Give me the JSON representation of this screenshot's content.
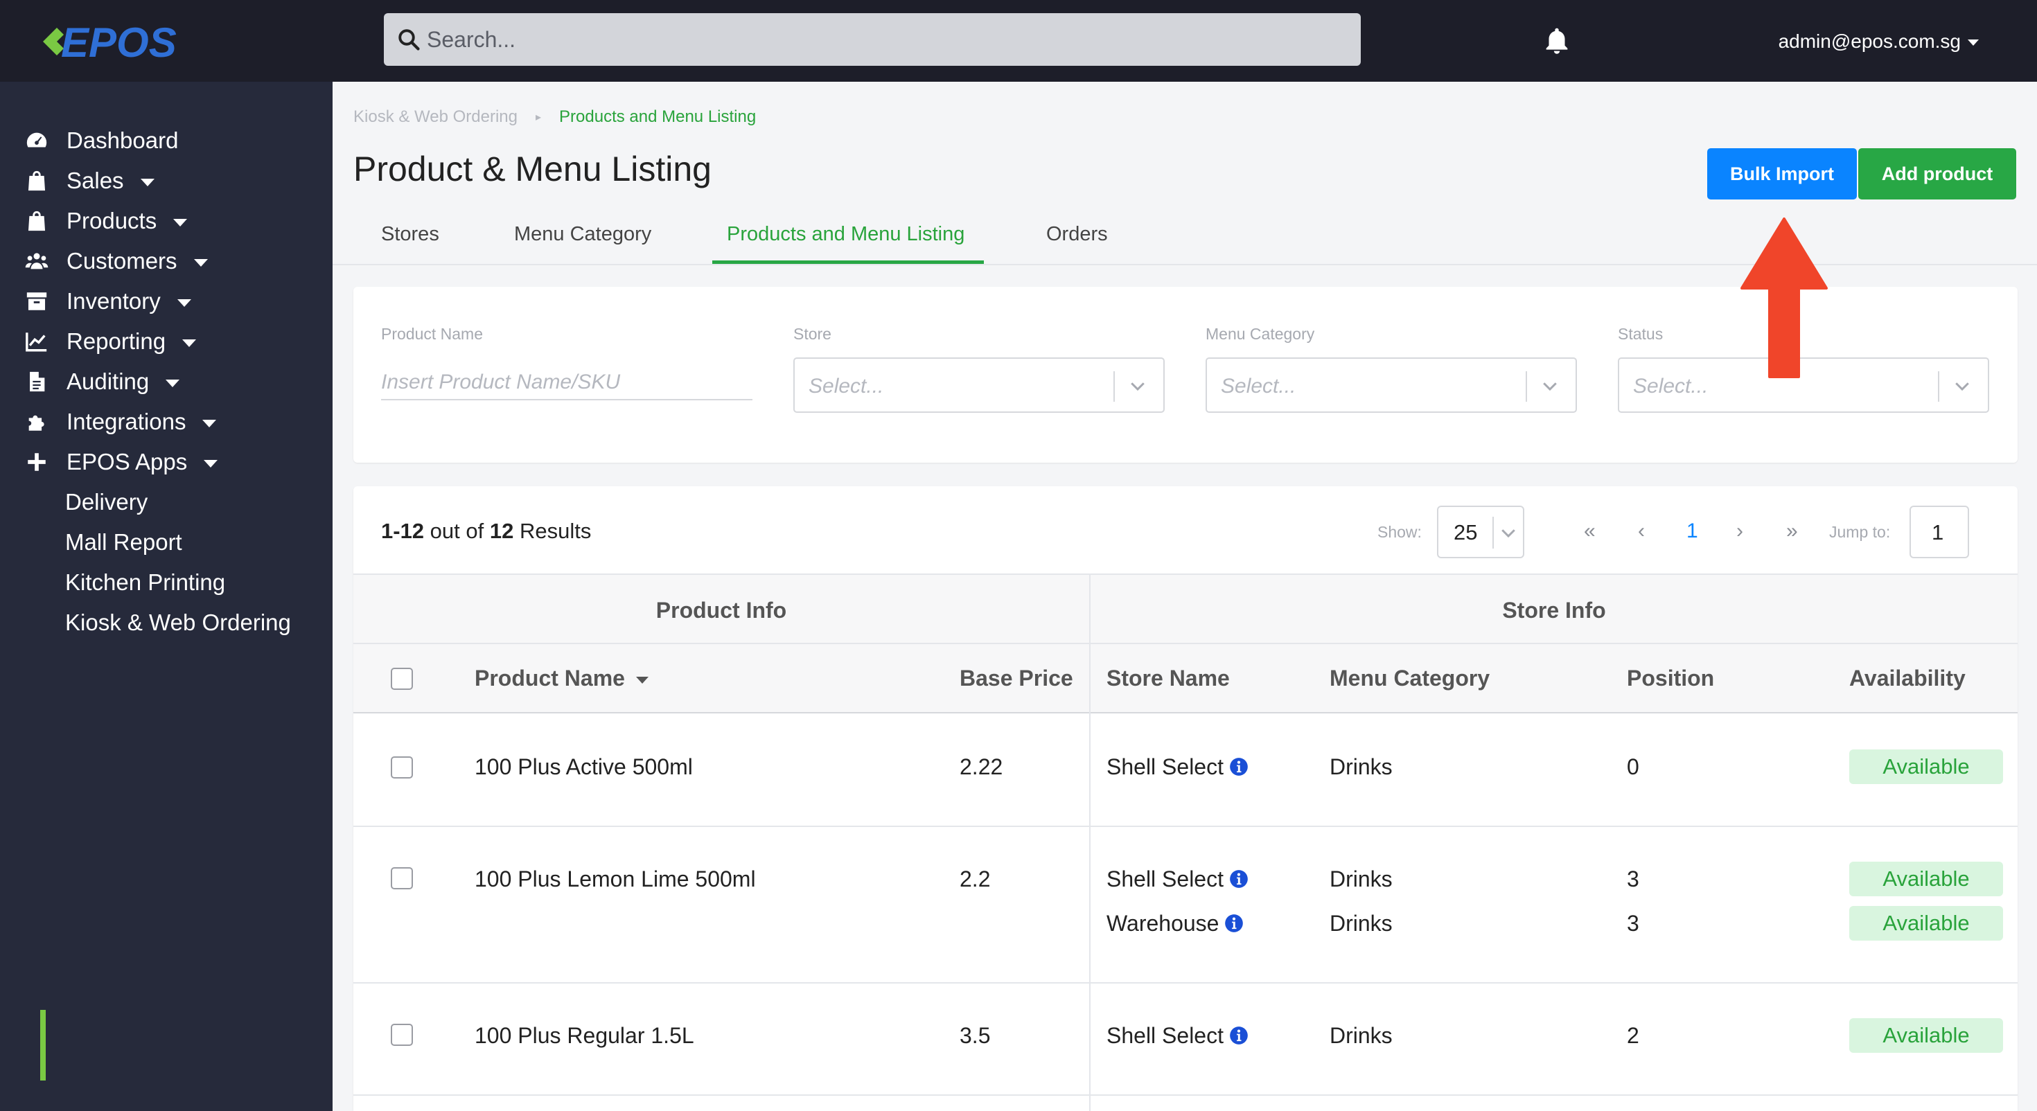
{
  "app": {
    "logo_text": "EPOS",
    "brand_color": "#7ac943",
    "accent": "#0a84ff",
    "success": "#28a745"
  },
  "topbar": {
    "search_placeholder": "Search...",
    "user": "admin@epos.com.sg",
    "icons": [
      "search-icon",
      "bell-icon"
    ]
  },
  "sidebar": {
    "items": [
      {
        "label": "Dashboard",
        "icon": "dashboard-icon"
      },
      {
        "label": "Sales",
        "icon": "shopping-bag-icon"
      },
      {
        "label": "Products",
        "icon": "shopping-bag-icon"
      },
      {
        "label": "Customers",
        "icon": "users-icon"
      },
      {
        "label": "Inventory",
        "icon": "archive-icon"
      },
      {
        "label": "Reporting",
        "icon": "chart-icon"
      },
      {
        "label": "Auditing",
        "icon": "document-icon"
      },
      {
        "label": "Integrations",
        "icon": "puzzle-icon"
      },
      {
        "label": "EPOS Apps",
        "icon": "plus-icon"
      }
    ],
    "sub_items": [
      {
        "label": "Delivery"
      },
      {
        "label": "Mall Report"
      },
      {
        "label": "Kitchen Printing"
      },
      {
        "label": "Kiosk & Web Ordering",
        "active": true
      }
    ]
  },
  "breadcrumb": {
    "parent": "Kiosk & Web Ordering",
    "current": "Products and Menu Listing"
  },
  "page": {
    "title": "Product & Menu Listing",
    "bulk_import": "Bulk Import",
    "add_product": "Add product"
  },
  "tabs": [
    {
      "label": "Stores"
    },
    {
      "label": "Menu Category"
    },
    {
      "label": "Products and Menu Listing",
      "active": true
    },
    {
      "label": "Orders"
    }
  ],
  "filters": {
    "product_name": {
      "label": "Product Name",
      "placeholder": "Insert Product Name/SKU"
    },
    "store": {
      "label": "Store",
      "placeholder": "Select..."
    },
    "menu_category": {
      "label": "Menu Category",
      "placeholder": "Select..."
    },
    "status": {
      "label": "Status",
      "placeholder": "Select..."
    }
  },
  "results": {
    "range": "1-12",
    "out_of": "out of",
    "total": "12",
    "results_word": "Results",
    "show_label": "Show:",
    "show_value": "25",
    "pagination": {
      "first": "«",
      "prev": "‹",
      "page": "1",
      "next": "›",
      "last": "»"
    },
    "jump_label": "Jump to:",
    "jump_value": "1"
  },
  "table": {
    "groups": {
      "product": "Product Info",
      "store": "Store Info"
    },
    "columns": {
      "product_name": "Product Name",
      "base_price": "Base Price",
      "store_name": "Store Name",
      "menu_category": "Menu Category",
      "position": "Position",
      "availability": "Availability"
    },
    "rows": [
      {
        "product_name": "100 Plus Active 500ml",
        "base_price": "2.22",
        "stores": [
          {
            "store_name": "Shell Select",
            "menu_category": "Drinks",
            "position": "0",
            "availability": "Available"
          }
        ]
      },
      {
        "product_name": "100 Plus Lemon Lime 500ml",
        "base_price": "2.2",
        "stores": [
          {
            "store_name": "Shell Select",
            "menu_category": "Drinks",
            "position": "3",
            "availability": "Available"
          },
          {
            "store_name": "Warehouse",
            "menu_category": "Drinks",
            "position": "3",
            "availability": "Available"
          }
        ]
      },
      {
        "product_name": "100 Plus Regular 1.5L",
        "base_price": "3.5",
        "stores": [
          {
            "store_name": "Shell Select",
            "menu_category": "Drinks",
            "position": "2",
            "availability": "Available"
          }
        ]
      }
    ]
  }
}
